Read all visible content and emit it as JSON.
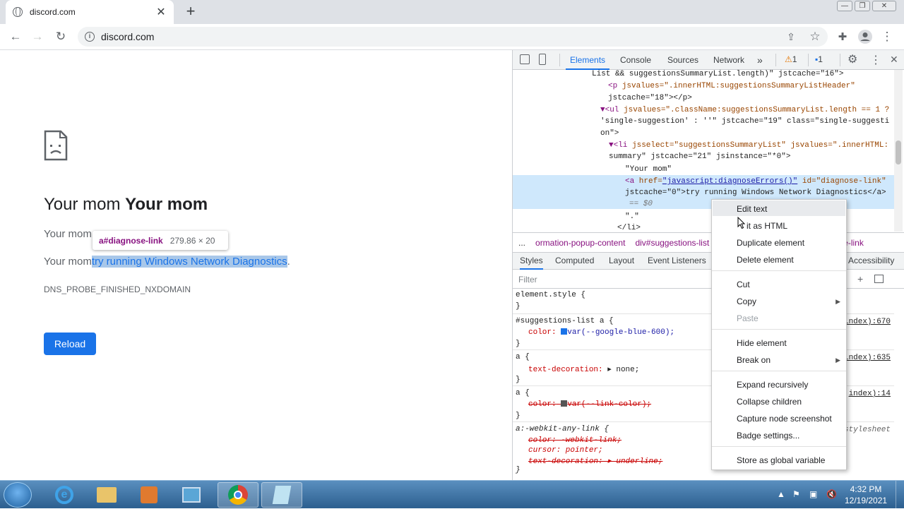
{
  "browser": {
    "tab_title": "discord.com",
    "url": "discord.com"
  },
  "page": {
    "heading_normal": "Your mom",
    "heading_bold": "Your mom",
    "line1": "Your mom",
    "line2_prefix": "Your mom",
    "line2_link": "try running Windows Network Diagnostics",
    "line2_suffix": ".",
    "error_code": "DNS_PROBE_FINISHED_NXDOMAIN",
    "reload_label": "Reload",
    "tooltip_selector": "a#diagnose-link",
    "tooltip_size": "279.86 × 20"
  },
  "devtools": {
    "tabs": [
      "Elements",
      "Console",
      "Sources",
      "Network"
    ],
    "active_tab": "Elements",
    "warnings_count": "1",
    "messages_count": "1",
    "source_lines": {
      "l1": "List && suggestionsSummaryList.length)\" jstcache=\"16\">",
      "l2a": "<p",
      "l2b": " jsvalues=\".innerHTML:suggestionsSummaryListHeader\"",
      "l3": "jstcache=\"18\"></p>",
      "l4a": "▼<ul",
      "l4b": " jsvalues=\".className:suggestionsSummaryList.length == 1 ?",
      "l5": "'single-suggestion' : ''\" jstcache=\"19\" class=\"single-suggesti",
      "l6": "on\">",
      "l7a": "▼<li",
      "l7b": " jsselect=\"suggestionsSummaryList\" jsvalues=\".innerHTML:",
      "l8": "summary\" jstcache=\"21\" jsinstance=\"*0\">",
      "l9": "\"Your mom\"",
      "l10a": "<a",
      "l10b": " href=",
      "l10c": "\"javascript:diagnoseErrors()\"",
      "l10d": " id=\"diagnose-link\"",
      "l11": "jstcache=\"0\">try running Windows Network Diagnostics</a>",
      "l12": "== $0",
      "l13": "\".\"",
      "l14": "</li>"
    },
    "breadcrumbs": [
      "...",
      "ormation-popup-content",
      "div#suggestions-list",
      "se-link"
    ],
    "subtabs": [
      "Styles",
      "Computed",
      "Layout",
      "Event Listeners",
      "Accessibility"
    ],
    "active_subtab": "Styles",
    "filter_placeholder": "Filter",
    "styles": {
      "r1_sel": "element.style {",
      "r1_close": "}",
      "r2_sel": "#suggestions-list a {",
      "r2_prop": "color:",
      "r2_val": "var(--google-blue-600);",
      "r2_src": "index):670",
      "r3_sel": "a {",
      "r3_prop": "text-decoration:",
      "r3_val": "▸ none;",
      "r3_src": "index):635",
      "r4_sel": "a {",
      "r4_prop": "color:",
      "r4_val": "var(--link-color);",
      "r4_src": "index):14",
      "r5_sel": "a:-webkit-any-link {",
      "r5_l1": "color: -webkit-link;",
      "r5_l2": "cursor: pointer;",
      "r5_l3": "text-decoration: ▸ underline;",
      "r5_src": "stylesheet",
      "close": "}"
    },
    "swatch_blue": "#1a73e8",
    "swatch_gray": "#555555"
  },
  "context_menu": {
    "items": [
      "Edit text",
      "Edit as HTML",
      "Duplicate element",
      "Delete element",
      "Cut",
      "Copy",
      "Paste",
      "Hide element",
      "Break on",
      "Expand recursively",
      "Collapse children",
      "Capture node screenshot",
      "Badge settings...",
      "Store as global variable"
    ],
    "visible_edit_html": "it as HTML"
  },
  "taskbar": {
    "time": "4:32 PM",
    "date": "12/19/2021"
  }
}
